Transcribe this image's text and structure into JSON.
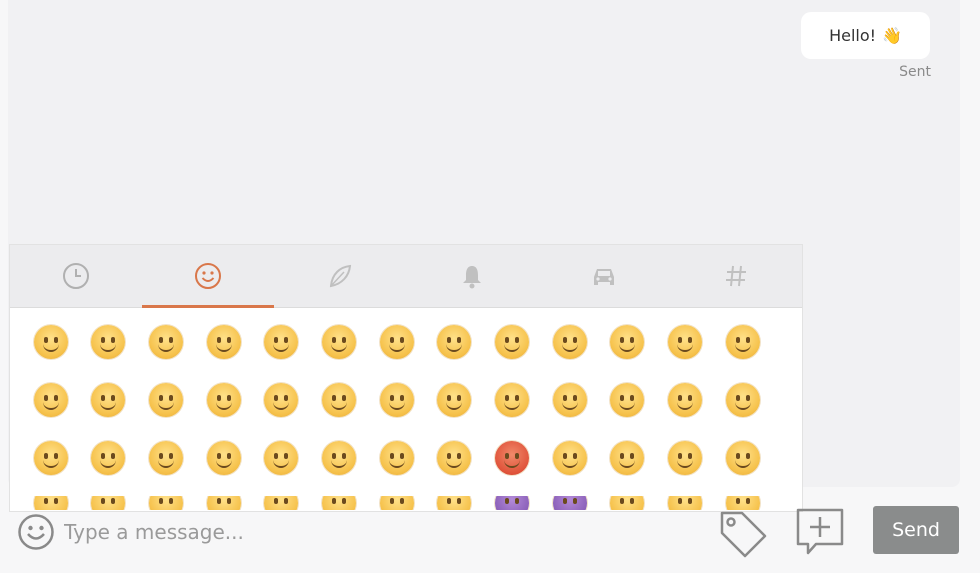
{
  "chat": {
    "messages": [
      {
        "text": "Hello!",
        "emoji": "👋",
        "status": "Sent"
      }
    ]
  },
  "emoji_picker": {
    "tabs": [
      {
        "name": "recent",
        "icon": "clock-icon",
        "active": false
      },
      {
        "name": "smileys",
        "icon": "smiley-icon",
        "active": true
      },
      {
        "name": "nature",
        "icon": "leaf-icon",
        "active": false
      },
      {
        "name": "objects",
        "icon": "bell-icon",
        "active": false
      },
      {
        "name": "travel",
        "icon": "car-icon",
        "active": false
      },
      {
        "name": "symbols",
        "icon": "hash-icon",
        "active": false
      }
    ],
    "active_color": "#d9774a"
  },
  "composer": {
    "placeholder": "Type a message...",
    "send_label": "Send"
  }
}
